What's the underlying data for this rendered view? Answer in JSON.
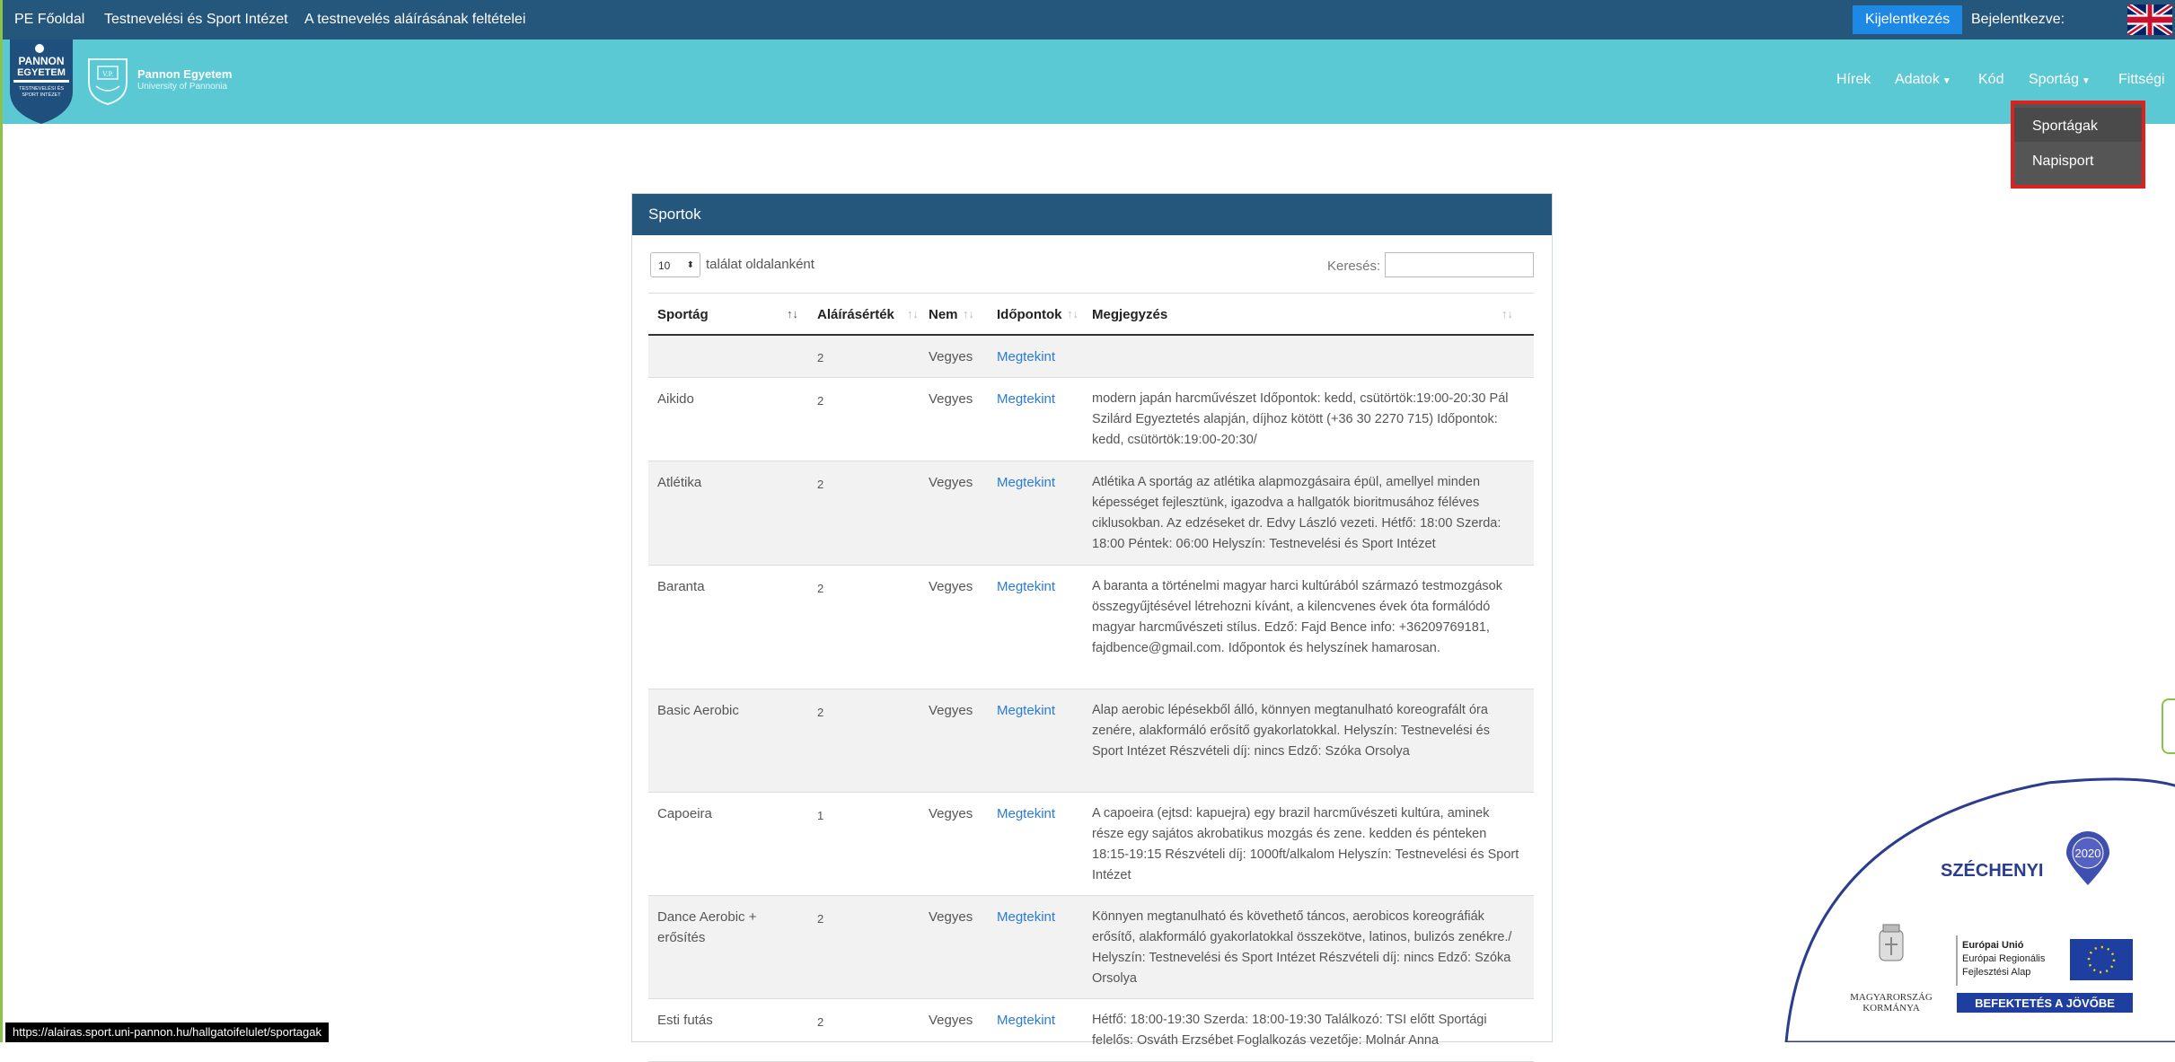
{
  "topbar": {
    "links": [
      "PE Főoldal",
      "Testnevelési és Sport Intézet",
      "A testnevelés aláírásának feltételei"
    ],
    "logout": "Kijelentkezés",
    "logged_in": "Bejelentkezve:"
  },
  "header": {
    "shield_text": [
      "PANNON",
      "EGYETEM",
      "TESTNEVELÉSI ÉS",
      "SPORT INTÉZET"
    ],
    "crest_text": "V.P.",
    "uni_name": "Pannon Egyetem",
    "uni_sub": "University of Pannonia",
    "nav": [
      {
        "label": "Hírek"
      },
      {
        "label": "Adatok"
      },
      {
        "label": "Kód"
      },
      {
        "label": "Sportág"
      },
      {
        "label": "Fittségi"
      }
    ],
    "dropdown": [
      "Sportágak",
      "Napisport"
    ]
  },
  "panel": {
    "title": "Sportok",
    "page_length": "10",
    "length_label": "találat oldalanként",
    "search_label": "Keresés:",
    "search_value": "",
    "columns": [
      "Sportág",
      "Aláírásérték",
      "Nem",
      "Időpontok",
      "Megjegyzés"
    ],
    "rows": [
      {
        "sport": "",
        "value": "2",
        "gender": "Vegyes",
        "link": "Megtekint",
        "note": ""
      },
      {
        "sport": "Aikido",
        "value": "2",
        "gender": "Vegyes",
        "link": "Megtekint",
        "note": "modern japán harcművészet Időpontok: kedd, csütörtök:19:00-20:30 Pál Szilárd Egyeztetés alapján, díjhoz kötött (+36 30 2270 715) Időpontok: kedd, csütörtök:19:00-20:30/"
      },
      {
        "sport": "Atlétika",
        "value": "2",
        "gender": "Vegyes",
        "link": "Megtekint",
        "note": "Atlétika A sportág az atlétika alapmozgásaira épül, amellyel minden képességet fejlesztünk, igazodva a hallgatók bioritmusához féléves ciklusokban. Az edzéseket dr. Edvy László vezeti. Hétfő: 18:00 Szerda: 18:00 Péntek: 06:00 Helyszín: Testnevelési és Sport Intézet"
      },
      {
        "sport": "Baranta",
        "value": "2",
        "gender": "Vegyes",
        "link": "Megtekint",
        "note": "A baranta a történelmi magyar harci kultúrából származó testmozgások összegyűjtésével létrehozni kívánt, a kilencvenes évek óta formálódó magyar harcművészeti stílus. Edző: Fajd Bence info: +36209769181, fajdbence@gmail.com. Időpontok és helyszínek hamarosan."
      },
      {
        "sport": "Basic Aerobic",
        "value": "2",
        "gender": "Vegyes",
        "link": "Megtekint",
        "note": "Alap aerobic lépésekből álló, könnyen megtanulható koreografált óra zenére, alakformáló erősítő gyakorlatokkal. Helyszín: Testnevelési és Sport Intézet Részvételi díj: nincs Edző: Szóka Orsolya"
      },
      {
        "sport": "Capoeira",
        "value": "1",
        "gender": "Vegyes",
        "link": "Megtekint",
        "note": "A capoeira (ejtsd: kapuejra) egy brazil harcművészeti kultúra, aminek része egy sajátos akrobatikus mozgás és zene. kedden és pénteken 18:15-19:15 Részvételi díj: 1000ft/alkalom Helyszín: Testnevelési és Sport Intézet"
      },
      {
        "sport": "Dance Aerobic + erősítés",
        "value": "2",
        "gender": "Vegyes",
        "link": "Megtekint",
        "note": "Könnyen megtanulható és követhető táncos, aerobicos koreográfiák erősítő, alakformáló gyakorlatokkal összekötve, latinos, bulizós zenékre./ Helyszín: Testnevelési és Sport Intézet Részvételi díj: nincs Edző: Szóka Orsolya"
      },
      {
        "sport": "Esti futás",
        "value": "2",
        "gender": "Vegyes",
        "link": "Megtekint",
        "note": "Hétfő: 18:00-19:30 Szerda: 18:00-19:30 Találkozó: TSI előtt Sportági felelős: Osváth Erzsébet Foglalkozás vezetője: Molnár Anna"
      }
    ]
  },
  "statusbar": "https://alairas.sport.uni-pannon.hu/hallgatoifelulet/sportagak",
  "szechenyi": {
    "title": "SZÉCHENYI",
    "year": "2020",
    "eu_line1": "Európai Unió",
    "eu_line2": "Európai Regionális",
    "eu_line3": "Fejlesztési Alap",
    "gov_line1": "MAGYARORSZÁG",
    "gov_line2": "KORMÁNYA",
    "banner": "BEFEKTETÉS A JÖVŐBE"
  },
  "colors": {
    "topbar": "#25567c",
    "header": "#5bc9d3",
    "logout": "#1e88e5",
    "link": "#2a7bd3",
    "highlight": "#e0201c"
  }
}
